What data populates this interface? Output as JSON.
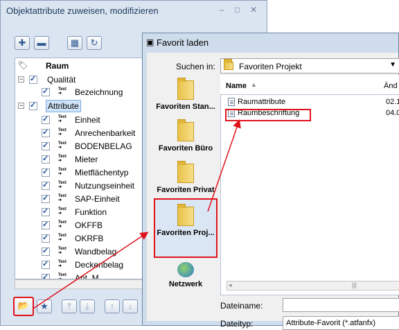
{
  "background_window": {
    "title": "Objektattribute zuweisen, modifizieren",
    "controls": {
      "minimize": "–",
      "maximize": "□",
      "close": "✕"
    },
    "tree": {
      "header": "Raum",
      "groups": [
        {
          "label": "Qualität",
          "items": [
            "Bezeichnung"
          ]
        },
        {
          "label": "Attribute",
          "items": [
            "Einheit",
            "Anrechenbarkeit",
            "BODENBELAG",
            "Mieter",
            "Mietflächentyp",
            "Nutzungseinheit",
            "SAP-Einheit",
            "Funktion",
            "OKFFB",
            "OKRFB",
            "Wandbelag",
            "Deckenbelag",
            "Ant. M..."
          ]
        }
      ],
      "text_icon": [
        "Text",
        "➜"
      ]
    }
  },
  "dialog": {
    "title": "Favorit laden",
    "look_in_label": "Suchen in:",
    "look_in_value": "Favoriten Projekt",
    "places": [
      {
        "label": "Favoriten Stan...",
        "icon": "folder-icon"
      },
      {
        "label": "Favoriten Büro",
        "icon": "folder-icon"
      },
      {
        "label": "Favoriten Privat",
        "icon": "folder-icon"
      },
      {
        "label": "Favoriten Proj...",
        "icon": "folder-icon"
      },
      {
        "label": "Netzwerk",
        "icon": "network-icon"
      }
    ],
    "columns": {
      "name": "Name",
      "date": "Änd"
    },
    "files": [
      {
        "name": "Raumattribute",
        "date": "02.1"
      },
      {
        "name": "Raumbeschriftung",
        "date": "04.0"
      }
    ],
    "filename_label": "Dateiname:",
    "filename_value": "",
    "filetype_label": "Dateityp:",
    "filetype_value": "Attribute-Favorit (*.atfanfx)"
  },
  "colors": {
    "highlight_red": "#e0121b",
    "selection": "#cfe3fa"
  }
}
